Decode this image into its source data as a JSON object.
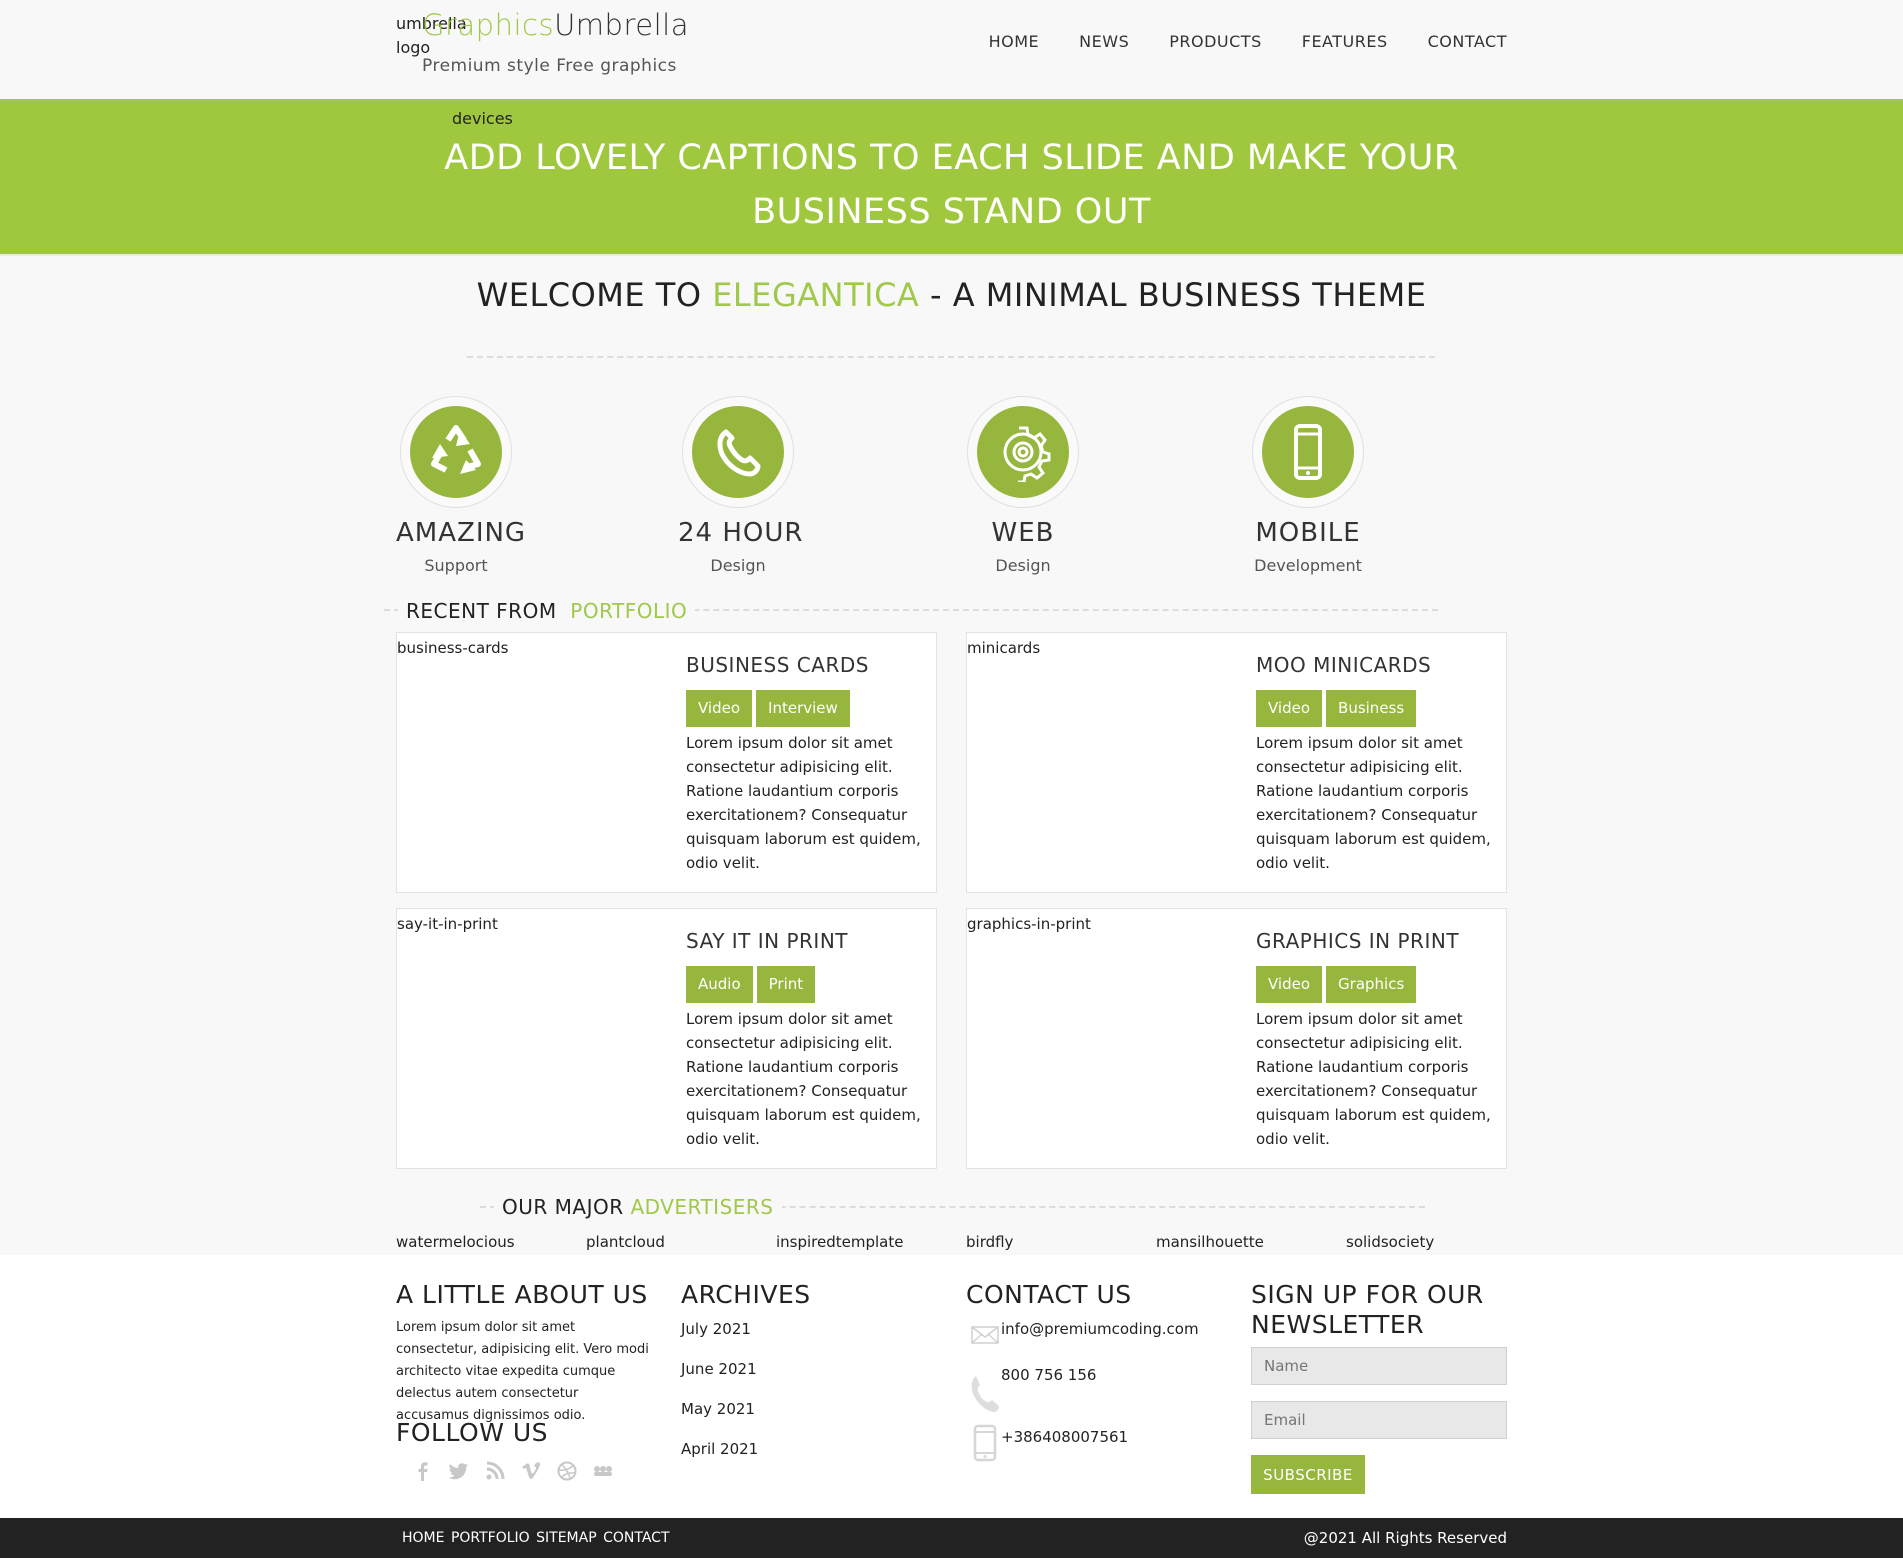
{
  "header": {
    "logo_alt": "umbrella logo",
    "logo_graphics": "Graphics",
    "logo_umbrella": "Umbrella",
    "tagline": "Premium style Free graphics",
    "nav": [
      "HOME",
      "NEWS",
      "PRODUCTS",
      "FEATURES",
      "CONTACT"
    ]
  },
  "banner": {
    "image_alt": "devices",
    "caption_line1": "ADD LOVELY CAPTIONS TO EACH SLIDE AND MAKE YOUR",
    "caption_line2": "BUSINESS STAND OUT",
    "color": "#a0c83f"
  },
  "welcome": {
    "prefix": "WELCOME TO ",
    "highlight": "ELEGANTICA",
    "suffix": " - A MINIMAL BUSINESS THEME"
  },
  "features": [
    {
      "icon": "recycle-icon",
      "title": "AMAZING",
      "subtitle": "Support"
    },
    {
      "icon": "phone-icon",
      "title": "24 HOUR",
      "subtitle": "Design"
    },
    {
      "icon": "gear-icon",
      "title": "WEB",
      "subtitle": "Design"
    },
    {
      "icon": "mobile-icon",
      "title": "MOBILE",
      "subtitle": "Development"
    }
  ],
  "portfolio": {
    "title_prefix": "RECENT FROM",
    "title_highlight": "PORTFOLIO",
    "items": [
      {
        "image_alt": "business-cards",
        "title": "BUSINESS CARDS",
        "tags": [
          "Video",
          "Interview"
        ],
        "text": "Lorem ipsum dolor sit amet consectetur adipisicing elit. Ratione laudantium corporis exercitationem? Consequatur quisquam laborum est quidem, odio velit."
      },
      {
        "image_alt": "minicards",
        "title": "MOO MINICARDS",
        "tags": [
          "Video",
          "Business"
        ],
        "text": "Lorem ipsum dolor sit amet consectetur adipisicing elit. Ratione laudantium corporis exercitationem? Consequatur quisquam laborum est quidem, odio velit."
      },
      {
        "image_alt": "say-it-in-print",
        "title": "SAY IT IN PRINT",
        "tags": [
          "Audio",
          "Print"
        ],
        "text": "Lorem ipsum dolor sit amet consectetur adipisicing elit. Ratione laudantium corporis exercitationem? Consequatur quisquam laborum est quidem, odio velit."
      },
      {
        "image_alt": "graphics-in-print",
        "title": "GRAPHICS IN PRINT",
        "tags": [
          "Video",
          "Graphics"
        ],
        "text": "Lorem ipsum dolor sit amet consectetur adipisicing elit. Ratione laudantium corporis exercitationem? Consequatur quisquam laborum est quidem, odio velit."
      }
    ]
  },
  "advertisers": {
    "title_prefix": "OUR MAJOR",
    "title_highlight": "ADVERTISERS",
    "items": [
      "watermelocious",
      "plantcloud",
      "inspiredtemplate",
      "birdfly",
      "mansilhouette",
      "solidsociety"
    ]
  },
  "footer": {
    "about_title": "A LITTLE ABOUT US",
    "about_text": "Lorem ipsum dolor sit amet consectetur, adipisicing elit. Vero modi architecto vitae expedita cumque delectus autem consectetur accusamus dignissimos odio.",
    "follow_title": "FOLLOW US",
    "social_icons": [
      "facebook-icon",
      "twitter-icon",
      "rss-icon",
      "vimeo-icon",
      "dribbble-icon",
      "flickr-icon"
    ],
    "archives_title": "ARCHIVES",
    "archives": [
      "July 2021",
      "June 2021",
      "May 2021",
      "April 2021"
    ],
    "contact_title": "CONTACT US",
    "email": "info@premiumcoding.com",
    "phone": "800 756 156",
    "mobile": "+386408007561",
    "newsletter_title_line1": "SIGN UP FOR OUR",
    "newsletter_title_line2": "NEWSLETTER",
    "name_placeholder": "Name",
    "email_placeholder": "Email",
    "subscribe_label": "SUBSCRIBE"
  },
  "bottom_bar": {
    "links": [
      "HOME",
      "PORTFOLIO",
      "SITEMAP",
      "CONTACT"
    ],
    "copyright": "@2021 All Rights Reserved"
  },
  "colors": {
    "accent": "#a0c84a",
    "icon_disc": "#96b63e",
    "bottom_bar": "#222222"
  }
}
